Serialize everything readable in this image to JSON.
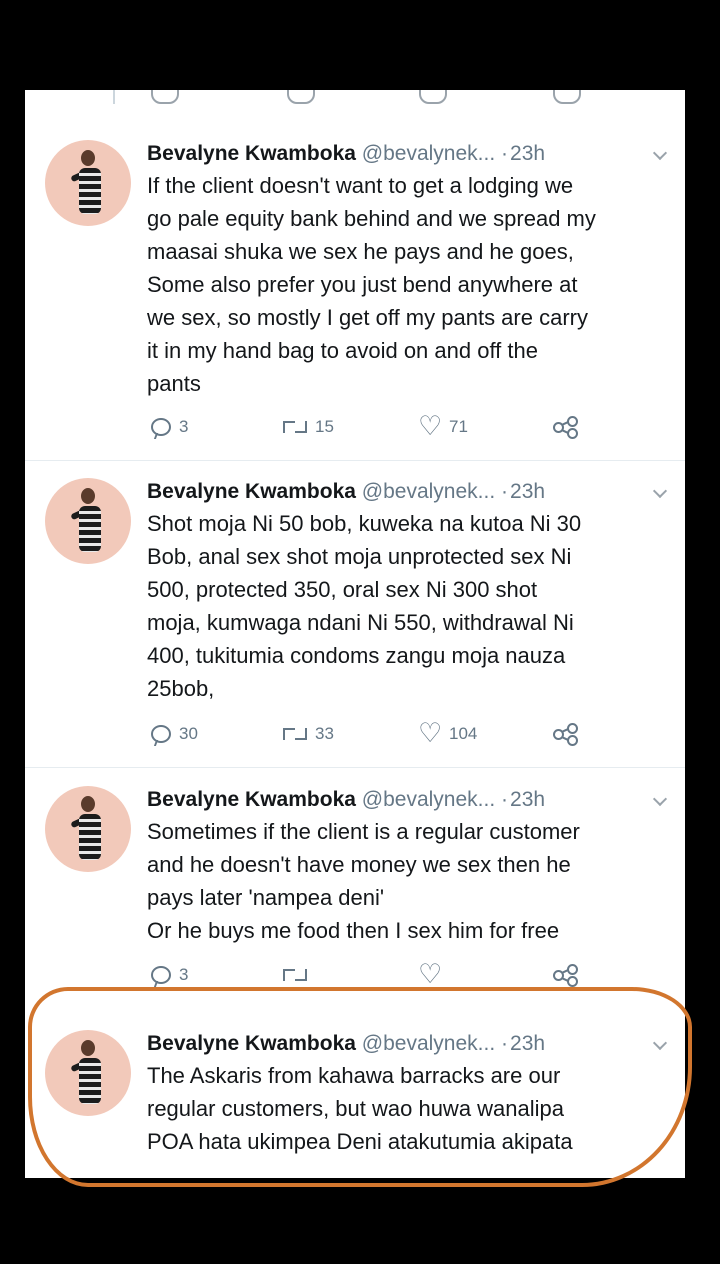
{
  "tweets": [
    {
      "name": "Bevalyne Kwamboka",
      "handle": "@bevalynek...",
      "dot": "·",
      "time": "23h",
      "text": "If the client doesn't want to get a lodging we\ngo pale equity bank behind and we spread my\nmaasai shuka we sex he pays and he goes,\nSome also prefer you just bend anywhere at\nwe sex, so mostly I get off my pants are carry\nit in my hand bag to avoid on and off the\npants",
      "replies": "3",
      "retweets": "15",
      "likes": "71"
    },
    {
      "name": "Bevalyne Kwamboka",
      "handle": "@bevalynek...",
      "dot": "·",
      "time": "23h",
      "text": "Shot moja Ni 50 bob, kuweka na kutoa Ni 30\nBob, anal sex shot moja unprotected sex Ni\n500, protected 350, oral sex Ni 300 shot\nmoja, kumwaga ndani Ni 550, withdrawal Ni\n400, tukitumia condoms zangu moja nauza\n25bob,",
      "replies": "30",
      "retweets": "33",
      "likes": "104"
    },
    {
      "name": "Bevalyne Kwamboka",
      "handle": "@bevalynek...",
      "dot": "·",
      "time": "23h",
      "text": "Sometimes if the client is a regular customer\nand he doesn't have money we sex then he\npays later 'nampea deni'\nOr he buys me food then I sex him for free",
      "replies": "3",
      "retweets": "",
      "likes": ""
    },
    {
      "name": "Bevalyne Kwamboka",
      "handle": "@bevalynek...",
      "dot": "·",
      "time": "23h",
      "text": "The Askaris from kahawa barracks are our\nregular customers, but wao huwa wanalipa\nPOA hata ukimpea Deni atakutumia akipata"
    }
  ],
  "colors": {
    "annotation_circle": "#d2762e",
    "avatar_bg": "#f2c9ba",
    "secondary_text": "#657786"
  }
}
